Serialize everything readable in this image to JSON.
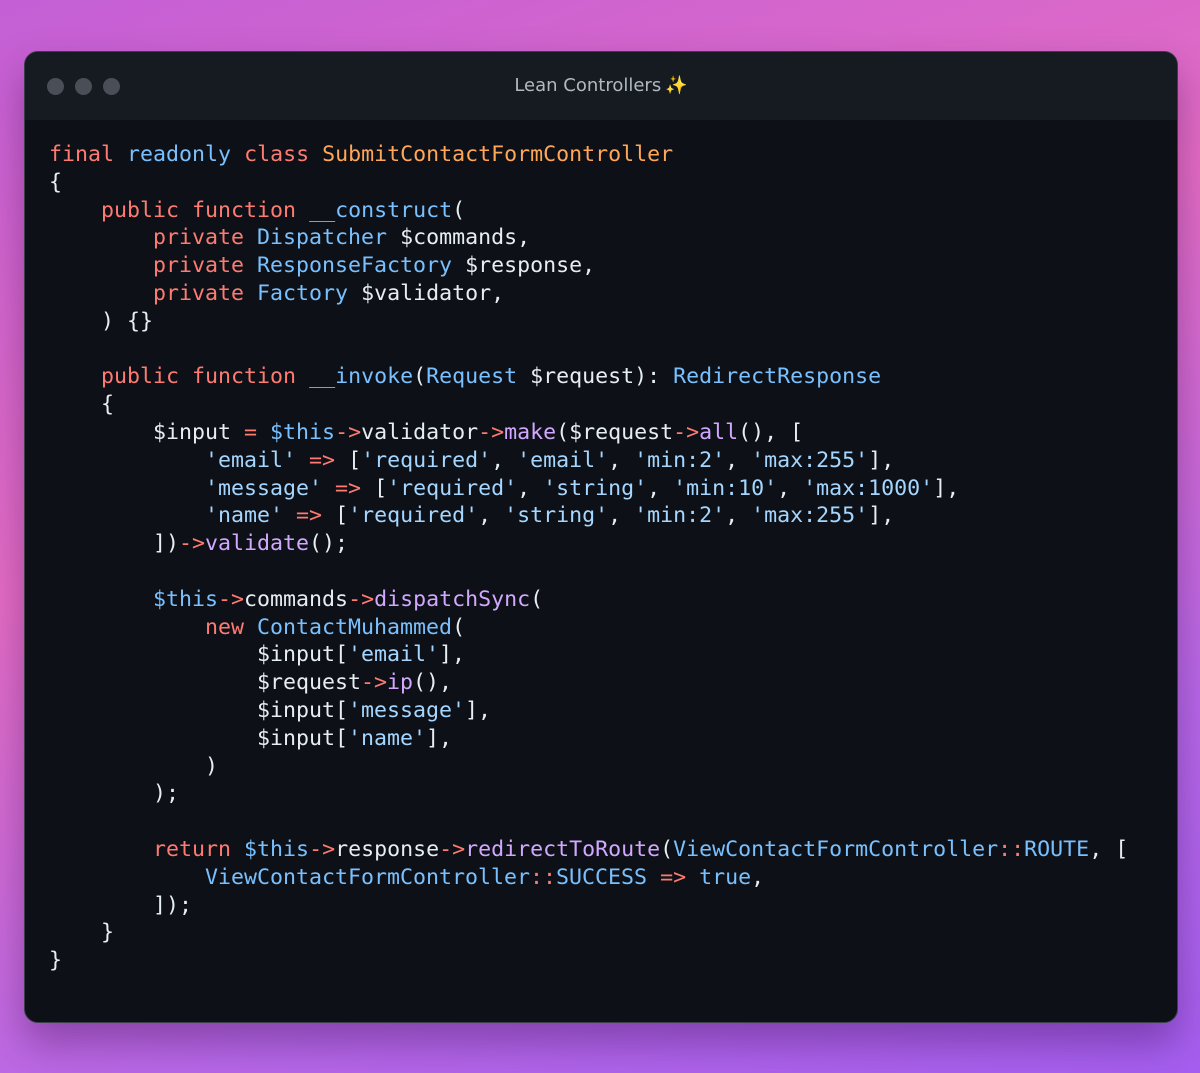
{
  "window": {
    "title": "Lean Controllers",
    "title_emoji": "✨",
    "traffic_lights": [
      "close-dot",
      "minimize-dot",
      "maximize-dot"
    ]
  },
  "colors": {
    "keyword": "#ff7b72",
    "type": "#79c0ff",
    "class_name": "#ffa657",
    "function": "#d2a8ff",
    "string": "#a5d6ff",
    "plain": "#e6edf3",
    "background": "#0d1117"
  },
  "code_lines": [
    [
      [
        "final",
        "kw"
      ],
      [
        " ",
        "pl"
      ],
      [
        "readonly",
        "ty"
      ],
      [
        " ",
        "pl"
      ],
      [
        "class",
        "kw"
      ],
      [
        " ",
        "pl"
      ],
      [
        "SubmitContactFormController",
        "cls"
      ]
    ],
    [
      [
        "{",
        "pl"
      ]
    ],
    [
      [
        "    ",
        "pl"
      ],
      [
        "public",
        "kw"
      ],
      [
        " ",
        "pl"
      ],
      [
        "function",
        "kw"
      ],
      [
        " ",
        "pl"
      ],
      [
        "__construct",
        "ty"
      ],
      [
        "(",
        "pl"
      ]
    ],
    [
      [
        "        ",
        "pl"
      ],
      [
        "private",
        "kw"
      ],
      [
        " ",
        "pl"
      ],
      [
        "Dispatcher",
        "ty"
      ],
      [
        " $commands,",
        "pl"
      ]
    ],
    [
      [
        "        ",
        "pl"
      ],
      [
        "private",
        "kw"
      ],
      [
        " ",
        "pl"
      ],
      [
        "ResponseFactory",
        "ty"
      ],
      [
        " $response,",
        "pl"
      ]
    ],
    [
      [
        "        ",
        "pl"
      ],
      [
        "private",
        "kw"
      ],
      [
        " ",
        "pl"
      ],
      [
        "Factory",
        "ty"
      ],
      [
        " $validator,",
        "pl"
      ]
    ],
    [
      [
        "    ) {}",
        "pl"
      ]
    ],
    [],
    [
      [
        "    ",
        "pl"
      ],
      [
        "public",
        "kw"
      ],
      [
        " ",
        "pl"
      ],
      [
        "function",
        "kw"
      ],
      [
        " ",
        "pl"
      ],
      [
        "__invoke",
        "ty"
      ],
      [
        "(",
        "pl"
      ],
      [
        "Request",
        "ty"
      ],
      [
        " $request): ",
        "pl"
      ],
      [
        "RedirectResponse",
        "ty"
      ]
    ],
    [
      [
        "    {",
        "pl"
      ]
    ],
    [
      [
        "        $input ",
        "pl"
      ],
      [
        "=",
        "op"
      ],
      [
        " ",
        "pl"
      ],
      [
        "$this",
        "ty"
      ],
      [
        "->",
        "op"
      ],
      [
        "validator",
        "pl"
      ],
      [
        "->",
        "op"
      ],
      [
        "make",
        "fn"
      ],
      [
        "($request",
        "pl"
      ],
      [
        "->",
        "op"
      ],
      [
        "all",
        "fn"
      ],
      [
        "(), [",
        "pl"
      ]
    ],
    [
      [
        "            ",
        "pl"
      ],
      [
        "'email'",
        "str"
      ],
      [
        " ",
        "pl"
      ],
      [
        "=>",
        "op"
      ],
      [
        " [",
        "pl"
      ],
      [
        "'required'",
        "str"
      ],
      [
        ", ",
        "pl"
      ],
      [
        "'email'",
        "str"
      ],
      [
        ", ",
        "pl"
      ],
      [
        "'min:2'",
        "str"
      ],
      [
        ", ",
        "pl"
      ],
      [
        "'max:255'",
        "str"
      ],
      [
        "],",
        "pl"
      ]
    ],
    [
      [
        "            ",
        "pl"
      ],
      [
        "'message'",
        "str"
      ],
      [
        " ",
        "pl"
      ],
      [
        "=>",
        "op"
      ],
      [
        " [",
        "pl"
      ],
      [
        "'required'",
        "str"
      ],
      [
        ", ",
        "pl"
      ],
      [
        "'string'",
        "str"
      ],
      [
        ", ",
        "pl"
      ],
      [
        "'min:10'",
        "str"
      ],
      [
        ", ",
        "pl"
      ],
      [
        "'max:1000'",
        "str"
      ],
      [
        "],",
        "pl"
      ]
    ],
    [
      [
        "            ",
        "pl"
      ],
      [
        "'name'",
        "str"
      ],
      [
        " ",
        "pl"
      ],
      [
        "=>",
        "op"
      ],
      [
        " [",
        "pl"
      ],
      [
        "'required'",
        "str"
      ],
      [
        ", ",
        "pl"
      ],
      [
        "'string'",
        "str"
      ],
      [
        ", ",
        "pl"
      ],
      [
        "'min:2'",
        "str"
      ],
      [
        ", ",
        "pl"
      ],
      [
        "'max:255'",
        "str"
      ],
      [
        "],",
        "pl"
      ]
    ],
    [
      [
        "        ])",
        "pl"
      ],
      [
        "->",
        "op"
      ],
      [
        "validate",
        "fn"
      ],
      [
        "();",
        "pl"
      ]
    ],
    [],
    [
      [
        "        ",
        "pl"
      ],
      [
        "$this",
        "ty"
      ],
      [
        "->",
        "op"
      ],
      [
        "commands",
        "pl"
      ],
      [
        "->",
        "op"
      ],
      [
        "dispatchSync",
        "fn"
      ],
      [
        "(",
        "pl"
      ]
    ],
    [
      [
        "            ",
        "pl"
      ],
      [
        "new",
        "kw"
      ],
      [
        " ",
        "pl"
      ],
      [
        "ContactMuhammed",
        "ty"
      ],
      [
        "(",
        "pl"
      ]
    ],
    [
      [
        "                $input[",
        "pl"
      ],
      [
        "'email'",
        "str"
      ],
      [
        "],",
        "pl"
      ]
    ],
    [
      [
        "                $request",
        "pl"
      ],
      [
        "->",
        "op"
      ],
      [
        "ip",
        "fn"
      ],
      [
        "(),",
        "pl"
      ]
    ],
    [
      [
        "                $input[",
        "pl"
      ],
      [
        "'message'",
        "str"
      ],
      [
        "],",
        "pl"
      ]
    ],
    [
      [
        "                $input[",
        "pl"
      ],
      [
        "'name'",
        "str"
      ],
      [
        "],",
        "pl"
      ]
    ],
    [
      [
        "            )",
        "pl"
      ]
    ],
    [
      [
        "        );",
        "pl"
      ]
    ],
    [],
    [
      [
        "        ",
        "pl"
      ],
      [
        "return",
        "kw"
      ],
      [
        " ",
        "pl"
      ],
      [
        "$this",
        "ty"
      ],
      [
        "->",
        "op"
      ],
      [
        "response",
        "pl"
      ],
      [
        "->",
        "op"
      ],
      [
        "redirectToRoute",
        "fn"
      ],
      [
        "(",
        "pl"
      ],
      [
        "ViewContactFormController",
        "ty"
      ],
      [
        "::",
        "op"
      ],
      [
        "ROUTE",
        "ty"
      ],
      [
        ", [",
        "pl"
      ]
    ],
    [
      [
        "            ",
        "pl"
      ],
      [
        "ViewContactFormController",
        "ty"
      ],
      [
        "::",
        "op"
      ],
      [
        "SUCCESS",
        "ty"
      ],
      [
        " ",
        "pl"
      ],
      [
        "=>",
        "op"
      ],
      [
        " ",
        "pl"
      ],
      [
        "true",
        "ty"
      ],
      [
        ",",
        "pl"
      ]
    ],
    [
      [
        "        ]);",
        "pl"
      ]
    ],
    [
      [
        "    }",
        "pl"
      ]
    ],
    [
      [
        "}",
        "pl"
      ]
    ]
  ]
}
